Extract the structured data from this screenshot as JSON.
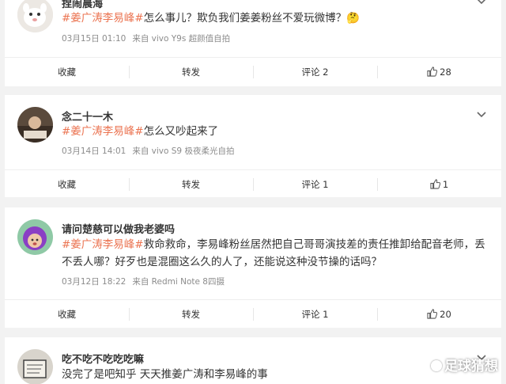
{
  "posts": [
    {
      "username": "捏闹晨海",
      "tag": "#姜广涛李易峰#",
      "text": "怎么事儿？欺负我们姜姜粉丝不爱玩微博？🤔",
      "time": "03月15日 01:10",
      "source": "来自 vivo Y9s 超颜值自拍",
      "actions": {
        "favorite": "收藏",
        "repost": "转发",
        "comment": "评论 2",
        "likes": "28"
      }
    },
    {
      "username": "念二十一木",
      "tag": "#姜广涛李易峰#",
      "text": "怎么又吵起来了",
      "time": "03月14日 14:01",
      "source": "来自 vivo S9 极夜柔光自拍",
      "actions": {
        "favorite": "收藏",
        "repost": "转发",
        "comment": "评论 1",
        "likes": "1"
      }
    },
    {
      "username": "请问楚慈可以做我老婆吗",
      "tag": "#姜广涛李易峰#",
      "text": "救命救命，李易峰粉丝居然把自己哥哥演技差的责任推卸给配音老师，丢不丢人哪？好歹也是混圈这么久的人了，还能说这种没节操的话吗？",
      "time": "03月12日 18:22",
      "source": "来自 Redmi Note 8四摄",
      "actions": {
        "favorite": "收藏",
        "repost": "转发",
        "comment": "评论 1",
        "likes": "20"
      }
    },
    {
      "username": "吃不吃不吃吃吃嘛",
      "text": "没完了是吧知乎 天天推姜广涛和李易峰的事"
    }
  ],
  "watermark": "足球猜想",
  "colors": {
    "tag": "#eb7350",
    "background": "#f2f2f2",
    "meta": "#8c8c8c"
  }
}
